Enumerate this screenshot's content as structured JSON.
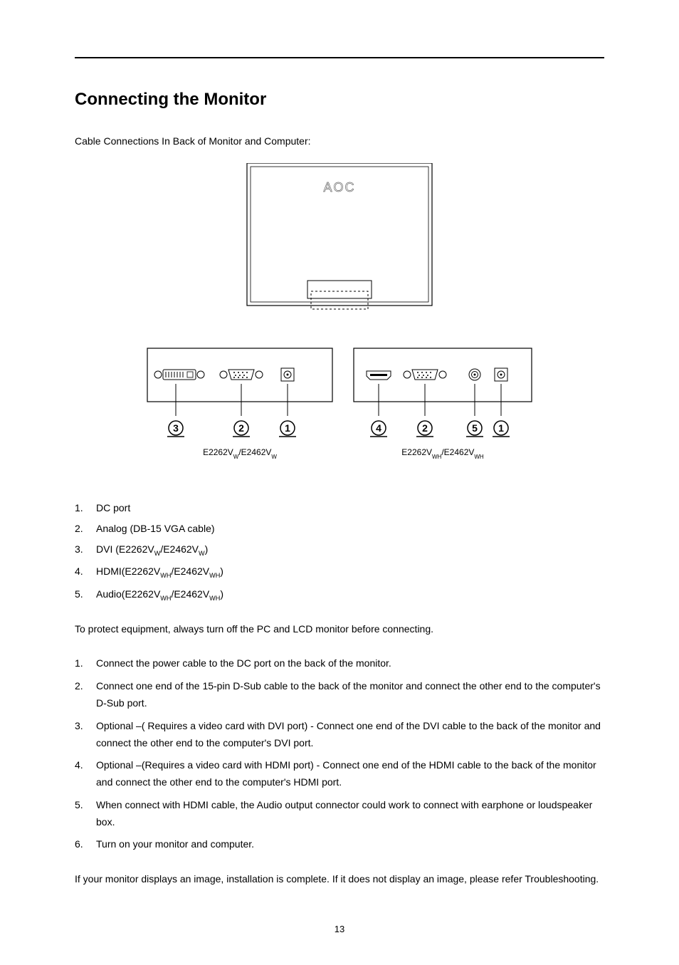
{
  "title": "Connecting the Monitor",
  "intro": "Cable Connections In Back of Monitor and Computer:",
  "diagram": {
    "brand": "AOC",
    "leftModel": {
      "a": "E2262V",
      "aw": "W",
      "b": "/E2462V",
      "bw": "W"
    },
    "rightModel": {
      "a": "E2262V",
      "aw": "WH",
      "b": "/E2462V",
      "bw": "WH"
    }
  },
  "portList": [
    {
      "num": "1.",
      "label": "DC port",
      "sub": ""
    },
    {
      "num": "2.",
      "label": "Analog (DB-15 VGA cable)",
      "sub": ""
    },
    {
      "num": "3.",
      "label_pre": "DVI (E2262V",
      "sub1": "W",
      "mid": "/E2462V",
      "sub2": "W",
      "post": ")"
    },
    {
      "num": "4.",
      "label_pre": "HDMI(E2262V",
      "sub1": "WH",
      "mid": "/E2462V",
      "sub2": "WH",
      "post": ")"
    },
    {
      "num": "5.",
      "label_pre": "Audio(E2262V",
      "sub1": "WH",
      "mid": "/E2462V",
      "sub2": "WH",
      "post": ")"
    }
  ],
  "protectNote": "To protect equipment, always turn off the PC and LCD monitor before connecting.",
  "steps": [
    {
      "num": "1.",
      "text": "Connect the power cable to the DC port on the back of the monitor."
    },
    {
      "num": "2.",
      "text": "Connect one end of the 15-pin D-Sub cable to the back of the monitor and connect the other end to the computer's D-Sub port."
    },
    {
      "num": "3.",
      "text": "Optional –( Requires a video card with DVI port) - Connect one end of the DVI cable to the back of the monitor and connect the other end to the computer's DVI port."
    },
    {
      "num": "4.",
      "text": "Optional –(Requires a video card with HDMI port) - Connect one end of the HDMI cable to the back of the monitor and connect the other end to the computer's HDMI port."
    },
    {
      "num": "5.",
      "text": "When connect with HDMI cable, the Audio output connector could work to connect with earphone or loudspeaker box."
    },
    {
      "num": "6.",
      "text": "Turn on your monitor and computer."
    }
  ],
  "closing": "If your monitor displays an image, installation is complete. If it does not display an image, please refer Troubleshooting.",
  "pageNumber": "13"
}
